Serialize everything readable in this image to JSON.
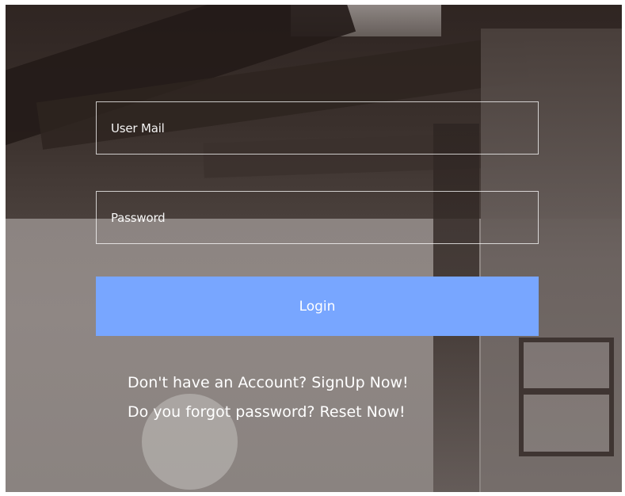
{
  "login": {
    "user_mail_placeholder": "User Mail",
    "password_placeholder": "Password",
    "login_button_label": "Login"
  },
  "links": {
    "signup_prompt": "Don't have an Account? ",
    "signup_action": "SignUp Now!",
    "reset_prompt": "Do you forgot password? ",
    "reset_action": "Reset Now!"
  },
  "colors": {
    "button_background": "#78a6ff",
    "text": "#ffffff",
    "field_border": "#ffffff"
  }
}
